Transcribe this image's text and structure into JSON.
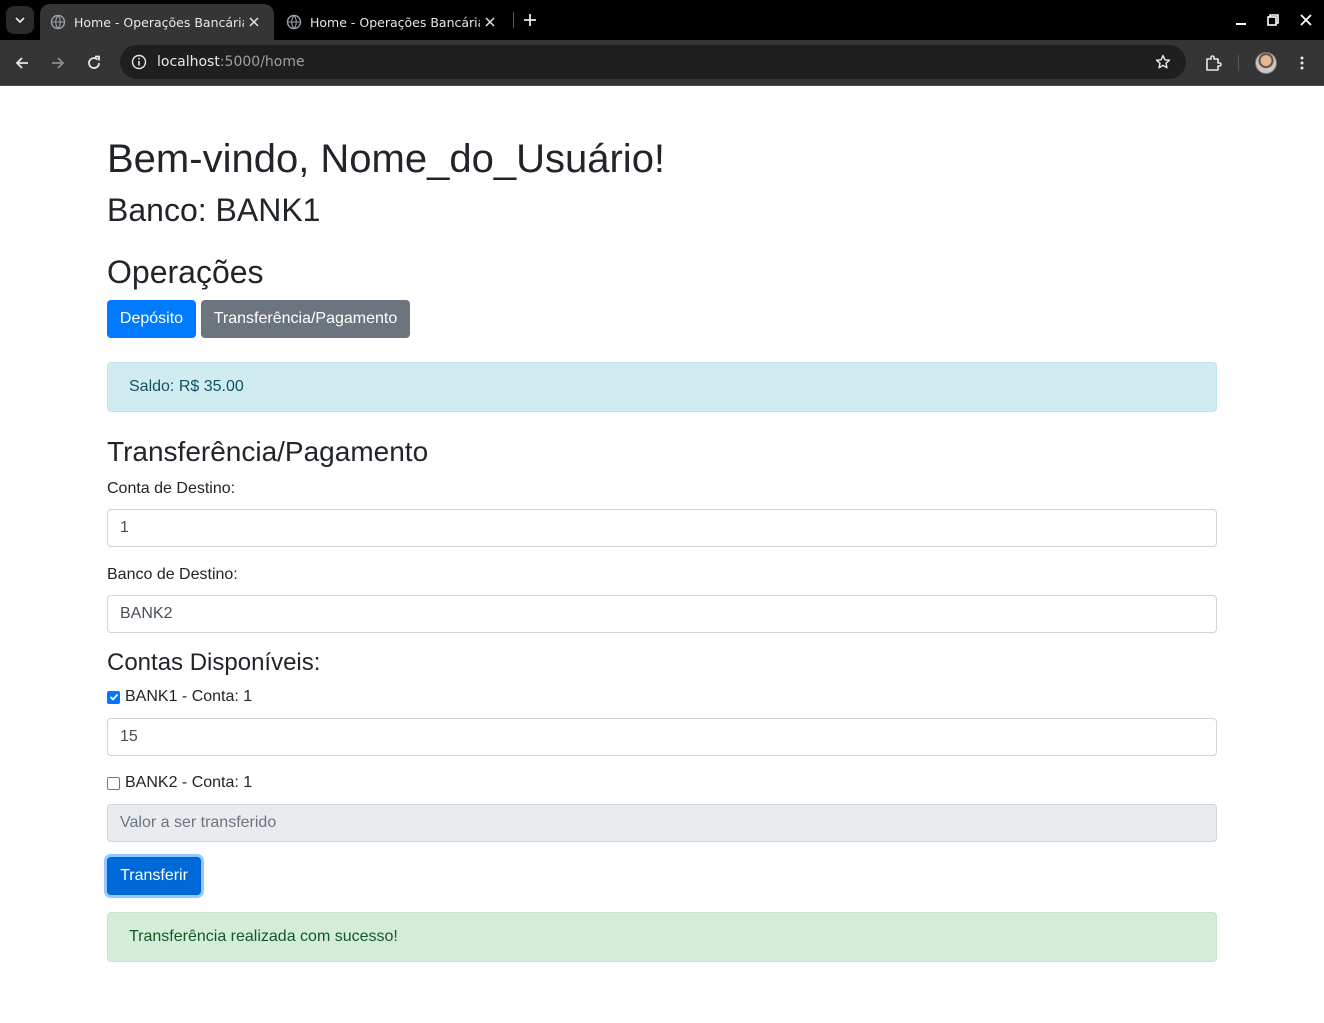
{
  "browser": {
    "tabs": [
      {
        "title": "Home - Operações Bancárias",
        "active": true
      },
      {
        "title": "Home - Operações Bancárias",
        "active": false
      }
    ],
    "url_host": "localhost",
    "url_rest": ":5000/home"
  },
  "page": {
    "welcome": "Bem-vindo, Nome_do_Usuário!",
    "bank": "Banco: BANK1",
    "operations_title": "Operações",
    "buttons": {
      "deposit": "Depósito",
      "transfer": "Transferência/Pagamento"
    },
    "balance": "Saldo: R$ 35.00",
    "form": {
      "title": "Transferência/Pagamento",
      "dest_account_label": "Conta de Destino:",
      "dest_account_value": "1",
      "dest_bank_label": "Banco de Destino:",
      "dest_bank_value": "BANK2",
      "accounts_title": "Contas Disponíveis:",
      "accounts": [
        {
          "label": "BANK1 - Conta: 1",
          "checked": true,
          "amount": "15",
          "placeholder": ""
        },
        {
          "label": "BANK2 - Conta: 1",
          "checked": false,
          "amount": "",
          "placeholder": "Valor a ser transferido"
        }
      ],
      "submit": "Transferir"
    },
    "success_message": "Transferência realizada com sucesso!"
  },
  "colors": {
    "primary": "#007bff",
    "secondary": "#6c757d",
    "info_bg": "#d1ecf1",
    "success_bg": "#d4edda"
  }
}
